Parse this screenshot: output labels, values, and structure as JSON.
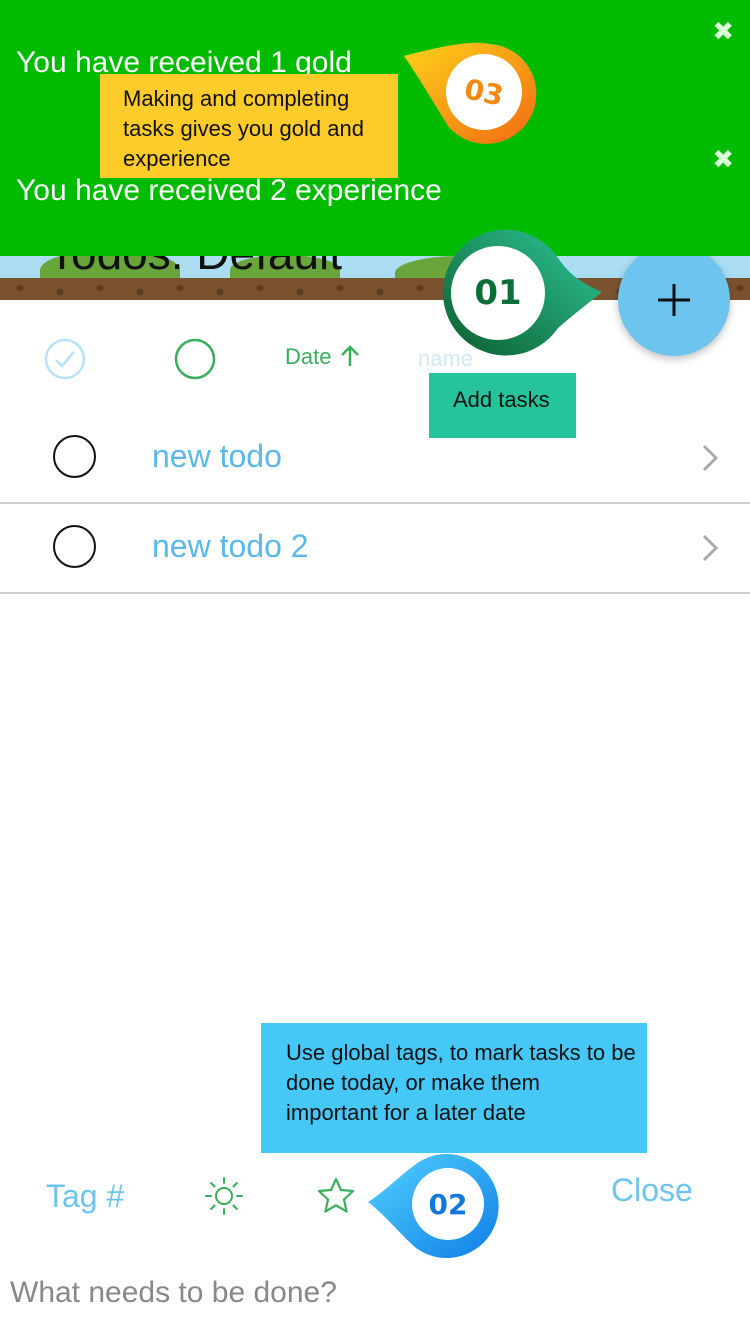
{
  "header": {
    "title": "Todos: Default"
  },
  "notifications": [
    {
      "text": "You have received 1 gold",
      "close_icon": "close-icon"
    },
    {
      "text": "You have received 2 experience",
      "close_icon": "close-icon"
    }
  ],
  "tour": {
    "step1": {
      "badge": "01",
      "text": "Add tasks",
      "color": "#26c49a"
    },
    "step2": {
      "badge": "02",
      "text": "Use global tags, to mark tasks to be done today, or make them important for a later date",
      "color": "#45c8f8"
    },
    "step3": {
      "badge": "03",
      "text": "Making and completing tasks gives you gold and experience",
      "color": "#fdcc2a"
    }
  },
  "add_button": {
    "icon": "plus-icon"
  },
  "sort_bar": {
    "check_all_icon": "check-circle-icon",
    "filter_icon": "circle-icon",
    "date_label": "Date",
    "date_icon": "arrow-up-icon",
    "name_label": "name"
  },
  "todos": [
    {
      "title": "new todo"
    },
    {
      "title": "new todo 2"
    }
  ],
  "bottom_bar": {
    "tag_label": "Tag #",
    "today_icon": "sun-icon",
    "important_icon": "star-icon",
    "close_label": "Close",
    "input_placeholder": "What needs to be done?"
  },
  "colors": {
    "toast_green": "#00bb00",
    "accent_blue": "#5bb8ea",
    "accent_green": "#3aae5a"
  }
}
